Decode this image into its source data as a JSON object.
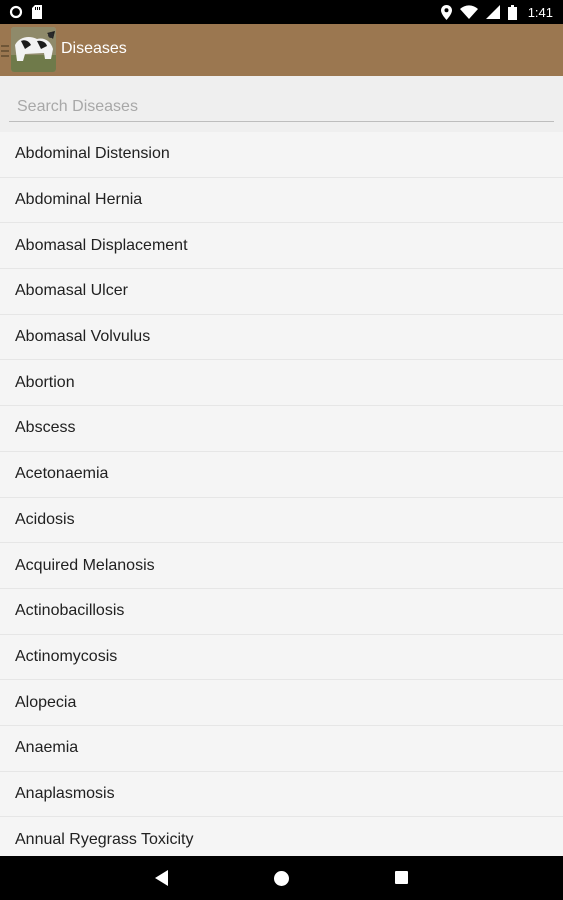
{
  "status_bar": {
    "time": "1:41",
    "icons": [
      "sync-icon",
      "sd-card-icon",
      "location-icon",
      "wifi-icon",
      "signal-icon",
      "battery-icon"
    ]
  },
  "app_bar": {
    "title": "Diseases",
    "background_color": "#9b7750",
    "icons": [
      "menu-icon",
      "app-logo-icon"
    ]
  },
  "search": {
    "placeholder": "Search Diseases",
    "value": ""
  },
  "diseases": [
    "Abdominal Distension",
    "Abdominal Hernia",
    "Abomasal Displacement",
    "Abomasal Ulcer",
    "Abomasal Volvulus",
    "Abortion",
    "Abscess",
    "Acetonaemia",
    "Acidosis",
    "Acquired Melanosis",
    "Actinobacillosis",
    "Actinomycosis",
    "Alopecia",
    "Anaemia",
    "Anaplasmosis",
    "Annual Ryegrass Toxicity"
  ],
  "nav_bar": {
    "icons": [
      "back-icon",
      "home-icon",
      "recent-apps-icon"
    ]
  }
}
